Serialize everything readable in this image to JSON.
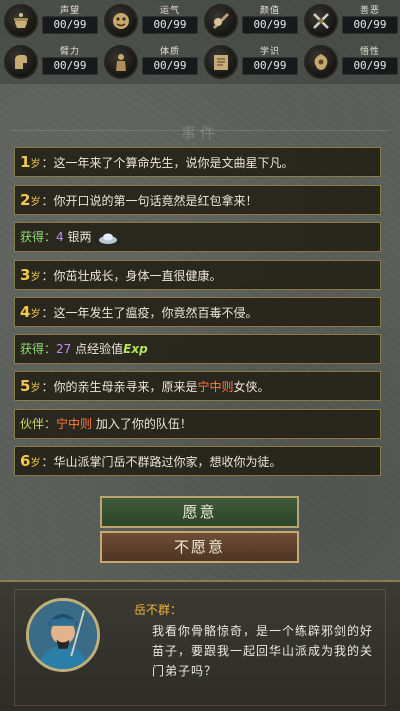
{
  "stats": [
    {
      "label": "声望",
      "value": "00/99",
      "icon": "reputation-icon"
    },
    {
      "label": "运气",
      "value": "00/99",
      "icon": "luck-icon"
    },
    {
      "label": "颜值",
      "value": "00/99",
      "icon": "appearance-icon"
    },
    {
      "label": "善恶",
      "value": "00/99",
      "icon": "morality-icon"
    },
    {
      "label": "臂力",
      "value": "00/99",
      "icon": "strength-icon"
    },
    {
      "label": "体质",
      "value": "00/99",
      "icon": "constitution-icon"
    },
    {
      "label": "学识",
      "value": "00/99",
      "icon": "knowledge-icon"
    },
    {
      "label": "悟性",
      "value": "00/99",
      "icon": "comprehension-icon"
    }
  ],
  "panel": {
    "title": "事件"
  },
  "events": [
    {
      "age": "1",
      "unit": "岁",
      "text": "：这一年来了个算命先生，说你是文曲星下凡。"
    },
    {
      "age": "2",
      "unit": "岁",
      "text": "：你开口说的第一句话竟然是红包拿来！"
    },
    {
      "gain_label": "获得",
      "amount": "4",
      "item": "银两"
    },
    {
      "age": "3",
      "unit": "岁",
      "text": "：你茁壮成长，身体一直很健康。"
    },
    {
      "age": "4",
      "unit": "岁",
      "text": "：这一年发生了瘟疫，你竟然百毒不侵。"
    },
    {
      "gain_label": "获得",
      "amount": "27",
      "item": "点经验值",
      "exp": "Exp"
    },
    {
      "age": "5",
      "unit": "岁",
      "text_before": "：你的亲生母亲寻来，原来是",
      "name": "宁中则",
      "text_after": "女侠。"
    },
    {
      "partner_label": "伙伴",
      "name": "宁中则",
      "text": "加入了你的队伍！"
    },
    {
      "age": "6",
      "unit": "岁",
      "text": "：华山派掌门岳不群路过你家，想收你为徒。"
    }
  ],
  "buttons": {
    "accept": "愿意",
    "decline": "不愿意"
  },
  "dialog": {
    "speaker": "岳不群：",
    "text": "我看你骨骼惊奇，是一个练辟邪剑的好苗子，要跟我一起回华山派成为我的关门弟子吗？"
  },
  "colors": {
    "age": "#f2c94c",
    "gain": "#8ee06f",
    "highlight": "#ff7c3a",
    "speaker": "#f0b43a"
  }
}
